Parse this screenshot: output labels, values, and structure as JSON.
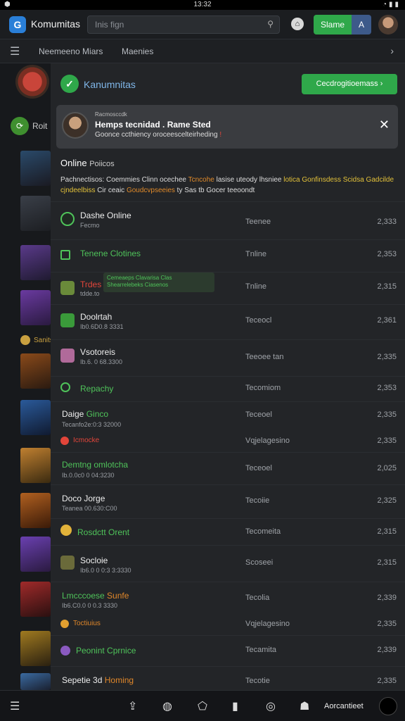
{
  "status": {
    "time": "13:32",
    "left_icon": "android-icon",
    "right_icons": "wifi signal battery"
  },
  "header": {
    "brand": "Komumitas",
    "search_placeholder": "Inis fign",
    "share_label": "Slame",
    "secondary_label": "A"
  },
  "tabs": {
    "t1": "Neemeeno Miars",
    "t2": "Maenies"
  },
  "left": {
    "green_label": "Roit",
    "small_label": "Sanits"
  },
  "panel": {
    "title": "Kanumnitas",
    "button": "Cecdrogitioemass",
    "notification": {
      "meta": "Racmosccdk",
      "title": "Hemps tecnidad . Rame Sted",
      "text": "Goonce ccthiency oroceescelteirheding",
      "alert": "!"
    },
    "online_label": "Online",
    "online_sub": "Poiicos",
    "description": {
      "a": "Pachnectisos: Coemmies Clinn ocechee",
      "b": "Tcncohe",
      "c": "lasise uteody lhsniee",
      "d": "lotica Gonfinsdess",
      "e": "Scidsa Gadcilde cjndeelbiss",
      "f": "Cir ceaic",
      "g": "Goudcvpseeies",
      "h": "ty Sas tb Gocer teeoondt"
    },
    "highlight": {
      "l1": "Cemeaeps Clavarisa Clas",
      "l2": "Shearrelebeks Ciasenos"
    },
    "rows": [
      {
        "name": "Dashe Online",
        "sub": "Fecmo",
        "mid": "Teenee",
        "val": "2,333"
      },
      {
        "name": "Tenene Clotines",
        "sub": "",
        "mid": "Tnline",
        "val": "2,353"
      },
      {
        "name": "Trdes",
        "sub": "tdde.to",
        "mid": "Tnline",
        "val": "2,315"
      },
      {
        "name": "Doolrtah",
        "sub": "Ib0.6D0.8 3331",
        "mid": "Teceocl",
        "val": "2,361"
      },
      {
        "name": "Vsotoreis",
        "sub": "Ib.6. 0 68.3300",
        "mid": "Teeoee tan",
        "val": "2,335"
      },
      {
        "name": "Repachy",
        "sub": "",
        "mid": "Tecomiom",
        "val": "2,353"
      },
      {
        "name": "Daige",
        "name2": "Ginco",
        "sub": "Tecanfo2e:0:3 32000",
        "mid": "Teceoel",
        "val": "2,335"
      },
      {
        "name": "Icmocke",
        "sub": "",
        "mid": "Vqjelagesino",
        "val": "2,335"
      },
      {
        "name": "Demtng omlotcha",
        "sub": "Ib.0.0c0 0 04:3230",
        "mid": "Teceoel",
        "val": "2,025"
      },
      {
        "name": "Doco Jorge",
        "sub": "Teanea 00.630:C00",
        "mid": "Tecoiie",
        "val": "2,325"
      },
      {
        "name": "Rosdctt Orent",
        "sub": "",
        "mid": "Tecomeita",
        "val": "2,315"
      },
      {
        "name": "Socloie",
        "sub": "Ib6.0 0 0:3 3:3330",
        "mid": "Scoseei",
        "val": "2,315"
      },
      {
        "name": "Lmcccoese",
        "name2": "Sunfe",
        "sub": "Ib6.C0.0 0 0.3 3330",
        "mid": "Tecolia",
        "val": "2,339"
      },
      {
        "name": "Toctiuius",
        "sub": "",
        "mid": "Vqjelagesino",
        "val": "2,335"
      },
      {
        "name": "Peonint Cprnice",
        "sub": "",
        "mid": "Tecamita",
        "val": "2,339"
      },
      {
        "name": "Sepetie 3d",
        "name2": "Homing",
        "sub": "",
        "mid": "Tecotie",
        "val": "2,335"
      }
    ]
  },
  "bottom": {
    "account": "Aorcantieet"
  }
}
